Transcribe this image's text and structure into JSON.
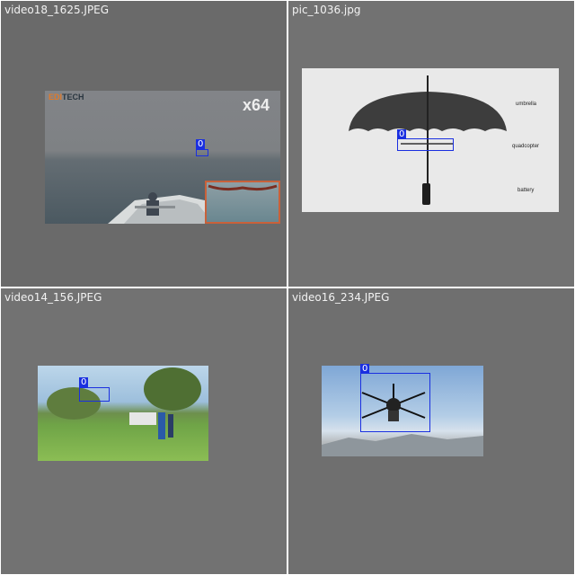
{
  "tiles": [
    {
      "filename": "video18_1625.JPEG",
      "label": "0",
      "overlay": {
        "logo_prefix": "EDI",
        "logo_suffix": "TECH",
        "zoom": "x64"
      }
    },
    {
      "filename": "pic_1036.jpg",
      "label": "0",
      "annotations": [
        "umbrella",
        "quadcopter",
        "battery"
      ]
    },
    {
      "filename": "video14_156.JPEG",
      "label": "0"
    },
    {
      "filename": "video16_234.JPEG",
      "label": "0"
    }
  ],
  "colors": {
    "box": "#1a2fe0",
    "label_text": "#ffffff",
    "filename_text": "#f2f2f2"
  }
}
